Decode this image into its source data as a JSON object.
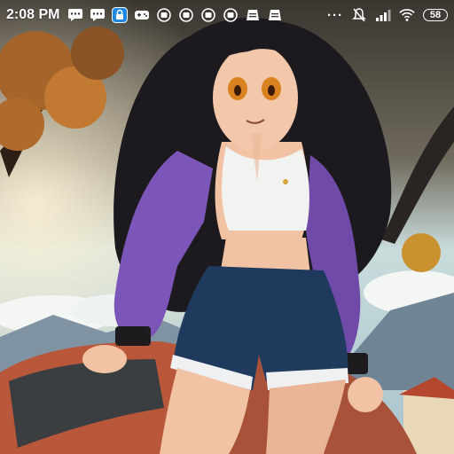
{
  "status_bar": {
    "time": "2:08 PM",
    "battery_level": "58",
    "left_icons": [
      "chat-bubble-icon",
      "chat-bubble-icon",
      "lock-notification-icon",
      "game-controller-icon",
      "app-notification-icon",
      "app-notification-icon",
      "app-notification-icon",
      "app-notification-icon",
      "notes-app-icon",
      "notes-app-icon"
    ],
    "right_icons": [
      "more-dots-icon",
      "mute-bell-icon",
      "signal-icon",
      "wifi-icon",
      "battery-icon"
    ],
    "more_indicator": "···"
  },
  "wallpaper": {
    "subject": "anime-character-illustration",
    "colors": {
      "sky": "#cfe2e4",
      "sky_top": "#3e3a35",
      "foliage": "#d48a2e",
      "jacket": "#7c55b8",
      "shorts": "#1f3a5c",
      "hair": "#1c1a1e",
      "car": "#c25a3d",
      "skin": "#f1c2a4"
    }
  }
}
